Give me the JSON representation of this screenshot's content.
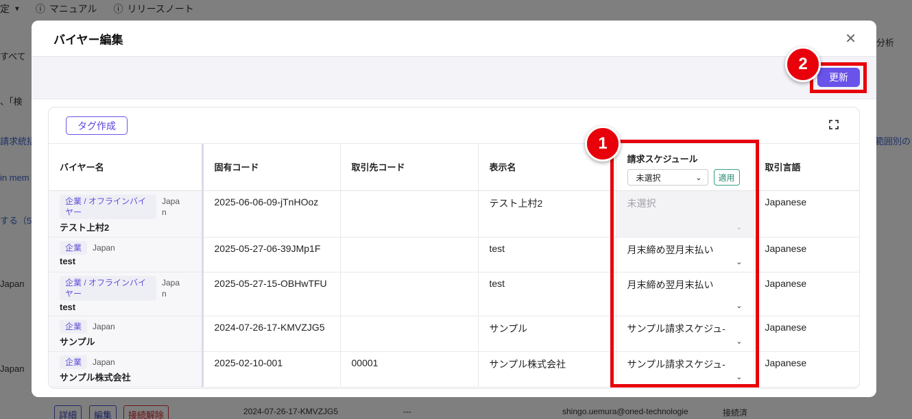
{
  "background": {
    "nav": {
      "settings_fragment": "定",
      "manual": "マニュアル",
      "release_notes": "リリースノート"
    },
    "left_fragments": [
      "すべて",
      "、「検",
      "請求統括",
      "in mem",
      "する（5",
      "Japan",
      "Japan"
    ],
    "right_fragments": [
      "分析",
      "範囲別の"
    ],
    "bottom_row": {
      "buttons": [
        "詳細",
        "編集",
        "接続解除"
      ],
      "code": "2024-07-26-17-KMVZJG5",
      "dash": "---",
      "email": "shingo.uemura@oned-technologie",
      "status": "接続済"
    }
  },
  "modal": {
    "title": "バイヤー編集",
    "update_button": "更新",
    "tag_create_button": "タグ作成",
    "columns": {
      "buyer_name": "バイヤー名",
      "unique_code": "固有コード",
      "partner_code": "取引先コード",
      "display_name": "表示名",
      "billing_schedule": "請求スケジュール",
      "trade_language": "取引言語"
    },
    "header_select": {
      "value": "未選択",
      "apply_label": "適用"
    },
    "rows": [
      {
        "category": "企業 / オフラインバイヤー",
        "country": "Japan",
        "name": "テスト上村2",
        "code": "2025-06-06-09-jTnHOoz",
        "partner_code": "",
        "display": "テスト上村2",
        "schedule": "未選択",
        "schedule_disabled": true,
        "language": "Japanese"
      },
      {
        "category": "企業",
        "country": "Japan",
        "name": "test",
        "code": "2025-05-27-06-39JMp1F",
        "partner_code": "",
        "display": "test",
        "schedule": "月末締め翌月末払い",
        "schedule_disabled": false,
        "language": "Japanese"
      },
      {
        "category": "企業 / オフラインバイヤー",
        "country": "Japan",
        "name": "test",
        "code": "2025-05-27-15-OBHwTFU",
        "partner_code": "",
        "display": "test",
        "schedule": "月末締め翌月末払い",
        "schedule_disabled": false,
        "language": "Japanese"
      },
      {
        "category": "企業",
        "country": "Japan",
        "name": "サンプル",
        "code": "2024-07-26-17-KMVZJG5",
        "partner_code": "",
        "display": "サンプル",
        "schedule": "サンプル請求スケジュ-",
        "schedule_disabled": false,
        "language": "Japanese"
      },
      {
        "category": "企業",
        "country": "Japan",
        "name": "サンプル株式会社",
        "code": "2025-02-10-001",
        "partner_code": "00001",
        "display": "サンプル株式会社",
        "schedule": "サンプル請求スケジュ-",
        "schedule_disabled": false,
        "language": "Japanese"
      }
    ]
  },
  "annotations": {
    "badge_1": "1",
    "badge_2": "2",
    "highlight_color": "#e8000b"
  }
}
